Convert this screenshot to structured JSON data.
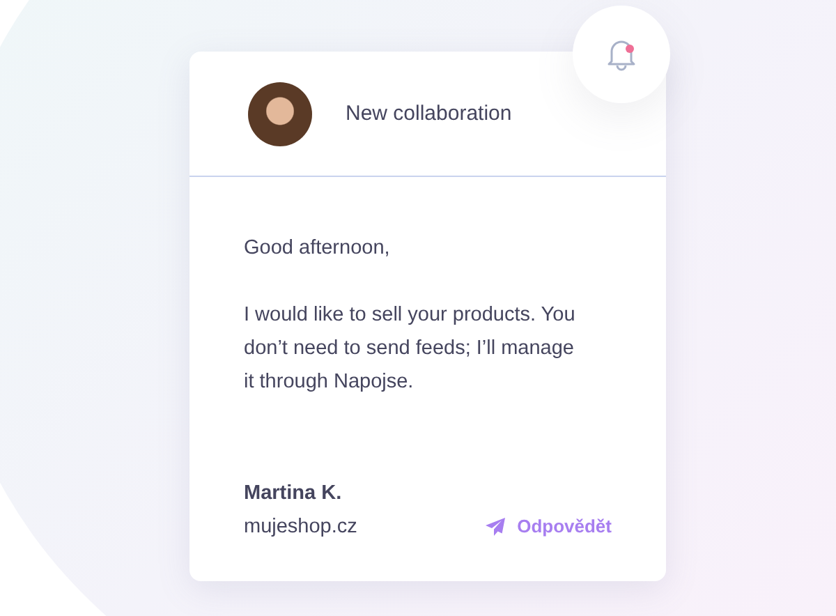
{
  "notification": {
    "unread": true
  },
  "message": {
    "title": "New collaboration",
    "greeting": "Good afternoon,",
    "body": "I would like to sell your products. You don’t need to send feeds; I’ll manage it through Napojse.",
    "sender": "Martina K.",
    "shop": "mujeshop.cz",
    "reply_label": "Odpovědět"
  }
}
